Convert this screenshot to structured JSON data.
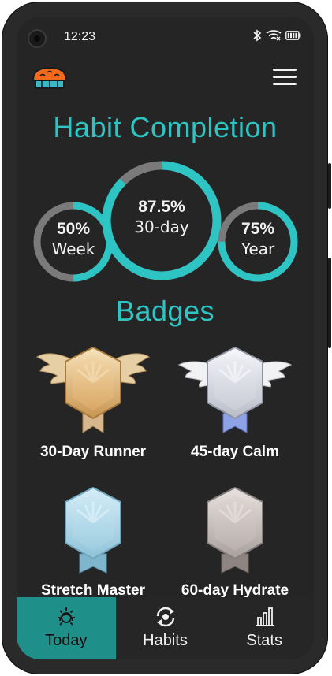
{
  "status_bar": {
    "time": "12:23",
    "icons": [
      "camera-icon",
      "bluetooth-icon",
      "wifi-icon",
      "battery-icon"
    ]
  },
  "header": {
    "logo": "pie-logo",
    "menu_icon": "hamburger-menu-icon"
  },
  "habit_completion": {
    "title": "Habit Completion",
    "rings": [
      {
        "id": "week",
        "percent_label": "50%",
        "period": "Week",
        "fraction": 0.5
      },
      {
        "id": "thirty_day",
        "percent_label": "87.5%",
        "period": "30-day",
        "fraction": 0.875
      },
      {
        "id": "year",
        "percent_label": "75%",
        "period": "Year",
        "fraction": 0.75
      }
    ]
  },
  "badges": {
    "title": "Badges",
    "items": [
      {
        "name": "30-Day Runner",
        "style": "gold-winged-badge"
      },
      {
        "name": "45-day Calm",
        "style": "silver-winged-badge"
      },
      {
        "name": "Stretch Master",
        "style": "light-blue-badge"
      },
      {
        "name": "60-day Hydrate",
        "style": "gray-badge"
      }
    ]
  },
  "tabbar": {
    "tabs": [
      {
        "label": "Today",
        "icon": "sun-icon",
        "active": true
      },
      {
        "label": "Habits",
        "icon": "habits-cycle-icon",
        "active": false
      },
      {
        "label": "Stats",
        "icon": "bar-chart-icon",
        "active": false
      }
    ]
  },
  "colors": {
    "accent": "#2ec4c4",
    "ring_track": "#7a7a7a",
    "active_tab": "#1f8f8a",
    "background": "#252525"
  }
}
